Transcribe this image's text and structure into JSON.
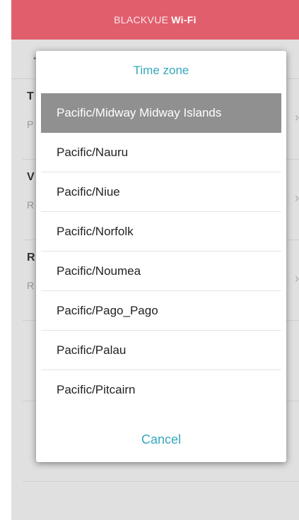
{
  "app": {
    "brand_prefix": "BLACKVUE",
    "brand_suffix": "Wi-Fi"
  },
  "background": {
    "rows": [
      {
        "title_fragment": "T",
        "subtitle_fragment": "P"
      },
      {
        "title_fragment": "V",
        "subtitle_fragment": "R"
      },
      {
        "title_fragment": "R",
        "subtitle_fragment": "R"
      }
    ]
  },
  "dialog": {
    "title": "Time zone",
    "items": [
      "Pacific/Midway Midway Islands",
      "Pacific/Nauru",
      "Pacific/Niue",
      "Pacific/Norfolk",
      "Pacific/Noumea",
      "Pacific/Pago_Pago",
      "Pacific/Palau",
      "Pacific/Pitcairn"
    ],
    "selected_index": 0,
    "cancel_label": "Cancel"
  },
  "colors": {
    "header": "#e15e6d",
    "accent": "#36a8bd",
    "selected_row": "#909090"
  }
}
